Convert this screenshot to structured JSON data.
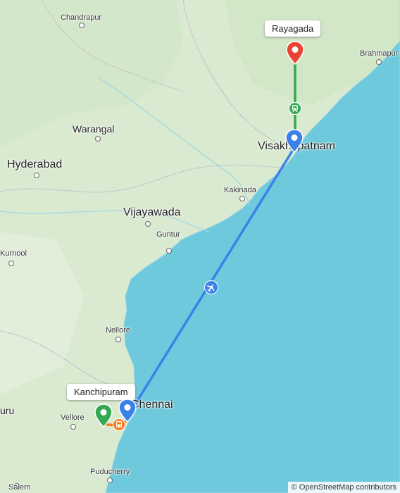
{
  "map": {
    "water_color": "#6ec9dc",
    "land_color": "#d9ead1",
    "route_colors": {
      "flight": "#3b82e8",
      "train": "#34a853",
      "destination": "#ea4335",
      "start": "#34a853",
      "bus": "#f57c20"
    }
  },
  "callouts": {
    "destination": "Rayagada",
    "origin": "Kanchipuram"
  },
  "places": {
    "chandrapur": "Chandrapur",
    "brahmapur": "Brahmapur",
    "warangal": "Warangal",
    "hyderabad": "Hyderabad",
    "visakhapatnam": "Visakhapatnam",
    "kakinada": "Kakinada",
    "vijayawada": "Vijayawada",
    "guntur": "Guntur",
    "kurnool": "Kurnool",
    "nellore": "Nellore",
    "chennai": "Chennai",
    "vellore": "Vellore",
    "puducherry": "Puducherry",
    "salem": "Salem",
    "bengaluru_partial": "uru"
  },
  "icons": {
    "flight": "airplane-icon",
    "train": "train-icon",
    "bus": "bus-icon",
    "destination_pin": "map-pin-icon",
    "origin_pin": "map-pin-icon"
  },
  "attribution": "© OpenStreetMap contributors"
}
